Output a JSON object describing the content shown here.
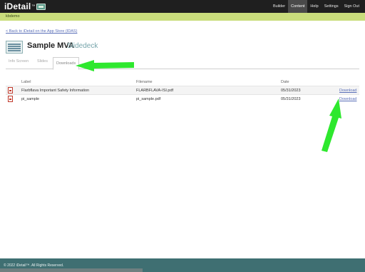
{
  "header": {
    "logo_text": "iDetail",
    "logo_tm": "™",
    "nav": [
      {
        "label": "Builder",
        "active": false
      },
      {
        "label": "Content",
        "active": true
      },
      {
        "label": "Help",
        "active": false
      },
      {
        "label": "Settings",
        "active": false
      },
      {
        "label": "Sign Out",
        "active": false
      }
    ]
  },
  "userbar": {
    "username": "kbdemo"
  },
  "back_link": "< Back to iDetail on the App Store (IDAS)",
  "page": {
    "title": "Sample MVA",
    "subtitle": "Slidedeck"
  },
  "tabs": [
    {
      "label": "Info Screen",
      "active": false
    },
    {
      "label": "Slides",
      "active": false
    },
    {
      "label": "Downloads",
      "active": true
    }
  ],
  "table": {
    "columns": [
      "Label",
      "Filename",
      "Date"
    ],
    "rows": [
      {
        "label": "Flarbflava Important Safety Information",
        "filename": "FLARBFLAVA-ISI.pdf",
        "date": "05/31/2023",
        "action": "Download"
      },
      {
        "label": "pi_sample",
        "filename": "pi_sample.pdf",
        "date": "05/31/2023",
        "action": "Download"
      }
    ]
  },
  "footer": {
    "copyright": "© 2022 iDetail™. All Rights Reserved."
  },
  "colors": {
    "topbar": "#1f1f1f",
    "userbar": "#c9dd7c",
    "link": "#5a6fb8",
    "footer": "#3f6f72",
    "arrow": "#2ee82e"
  },
  "icons": [
    "idetail-logo-icon",
    "slidedeck-icon",
    "pdf-icon"
  ]
}
